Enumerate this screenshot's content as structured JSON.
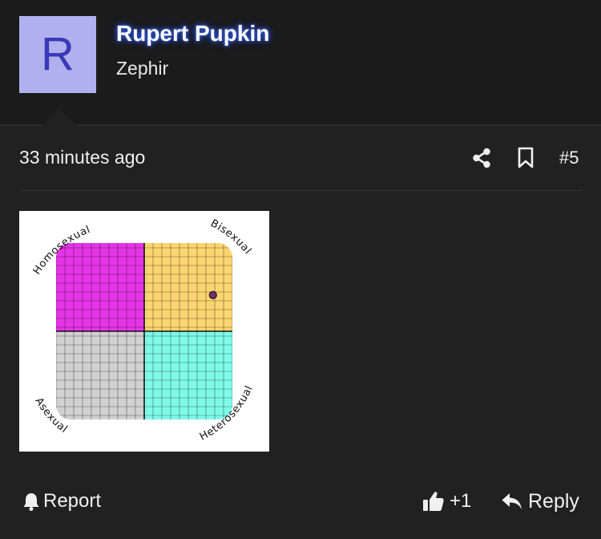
{
  "post": {
    "author": {
      "avatar_letter": "R",
      "name": "Rupert Pupkin",
      "title": "Zephir",
      "avatar_bg": "#b0b0ee",
      "avatar_fg": "#3a3ab8"
    },
    "timestamp": "33 minutes ago",
    "post_number": "#5",
    "actions": {
      "share_icon": "share-icon",
      "bookmark_icon": "bookmark-icon",
      "report_label": "Report",
      "like_count": "+1",
      "reply_label": "Reply"
    }
  },
  "chart_data": {
    "type": "scatter",
    "quadrants": [
      {
        "label": "Homosexual",
        "position": "top-left",
        "color": "#e535e6"
      },
      {
        "label": "Bisexual",
        "position": "top-right",
        "color": "#fbd570"
      },
      {
        "label": "Asexual",
        "position": "bottom-left",
        "color": "#d1d1d1"
      },
      {
        "label": "Heterosexual",
        "position": "bottom-right",
        "color": "#7ffae9"
      }
    ],
    "xlim": [
      -10,
      10
    ],
    "ylim": [
      -10,
      10
    ],
    "grid": true,
    "points": [
      {
        "x": 7.8,
        "y": 4.1,
        "color": "#7a2a6e"
      }
    ]
  }
}
